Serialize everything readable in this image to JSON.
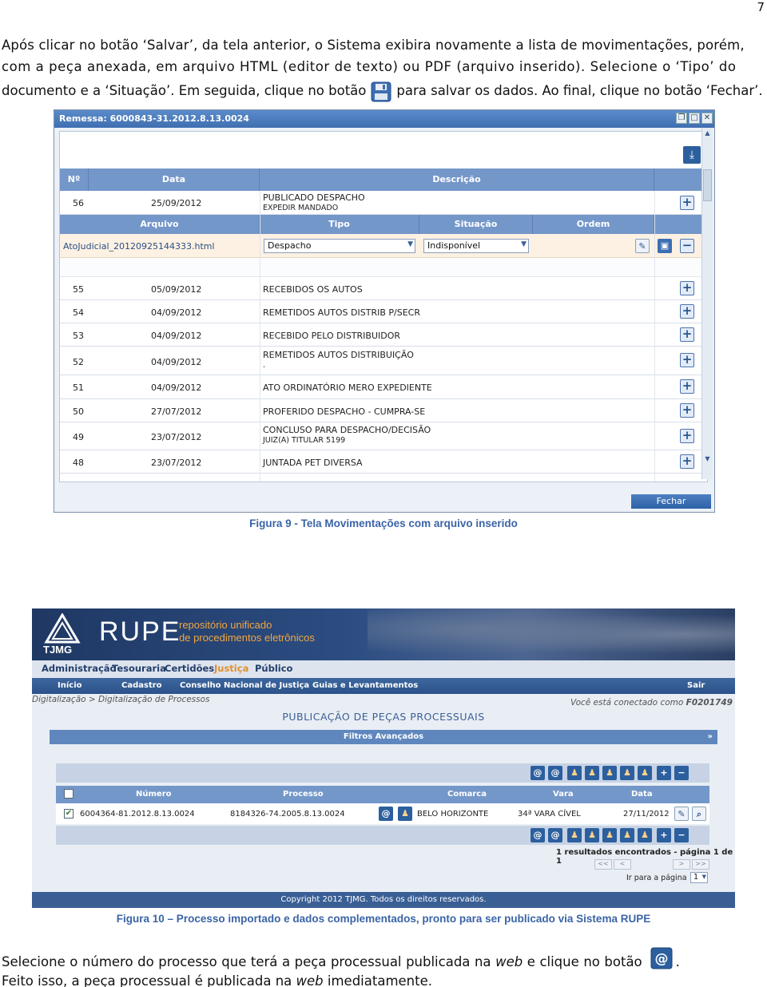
{
  "page_number": "7",
  "intro": {
    "line1": "Após clicar no botão ‘Salvar’, da tela anterior, o Sistema exibira novamente a lista de movimentações, porém,",
    "line2": "com a peça anexada, em arquivo HTML (editor de texto) ou PDF (arquivo inserido). Selecione o ‘Tipo’ do",
    "line3a": "documento e a ‘Situação’. Em seguida, clique no botão",
    "line3b": "para salvar os dados. Ao final, clique no botão ‘Fechar’."
  },
  "fig9": {
    "window_title": "Remessa: 6000843-31.2012.8.13.0024",
    "headers": {
      "num": "Nº",
      "date": "Data",
      "desc": "Descrição"
    },
    "attach_headers": {
      "file": "Arquivo",
      "type": "Tipo",
      "status": "Situação",
      "order": "Ordem"
    },
    "selected_row": {
      "num": "56",
      "date": "25/09/2012",
      "desc1": "PUBLICADO DESPACHO",
      "desc2": "EXPEDIR MANDADO"
    },
    "attachment": {
      "file": "AtoJudicial_20120925144333.html",
      "type": "Despacho",
      "status": "Indisponível"
    },
    "rows": [
      {
        "num": "55",
        "date": "05/09/2012",
        "desc1": "RECEBIDOS OS AUTOS",
        "desc2": ""
      },
      {
        "num": "54",
        "date": "04/09/2012",
        "desc1": "REMETIDOS AUTOS DISTRIB P/SECR",
        "desc2": ""
      },
      {
        "num": "53",
        "date": "04/09/2012",
        "desc1": "RECEBIDO PELO DISTRIBUIDOR",
        "desc2": ""
      },
      {
        "num": "52",
        "date": "04/09/2012",
        "desc1": "REMETIDOS AUTOS DISTRIBUIÇÃO",
        "desc2": "."
      },
      {
        "num": "51",
        "date": "04/09/2012",
        "desc1": "ATO ORDINATÓRIO MERO EXPEDIENTE",
        "desc2": ""
      },
      {
        "num": "50",
        "date": "27/07/2012",
        "desc1": "PROFERIDO DESPACHO - CUMPRA-SE",
        "desc2": ""
      },
      {
        "num": "49",
        "date": "23/07/2012",
        "desc1": "CONCLUSO PARA DESPACHO/DECISÃO",
        "desc2": "JUIZ(A) TITULAR 5199"
      },
      {
        "num": "48",
        "date": "23/07/2012",
        "desc1": "JUNTADA PET DIVERSA",
        "desc2": ""
      }
    ],
    "close_label": "Fechar",
    "caption": "Figura 9 - Tela Movimentações com arquivo inserido"
  },
  "fig10": {
    "logo_text": "TJMG",
    "brand": "RUPE",
    "brand_sub1": "repositório unificado",
    "brand_sub2": "de procedimentos eletrônicos",
    "menu": [
      "Administração",
      "Tesouraria",
      "Certidões",
      "Justiça",
      "Público"
    ],
    "submenu": [
      "Início",
      "Cadastro",
      "Conselho Nacional de Justiça",
      "Guias e Levantamentos"
    ],
    "exit": "Sair",
    "breadcrumb": "Digitalização > Digitalização de Processos",
    "connected": "Você está conectado como",
    "user": "F0201749",
    "page_title": "PUBLICAÇÃO DE PEÇAS PROCESSUAIS",
    "filters": "Filtros Avançados",
    "table_headers": {
      "numero": "Número",
      "processo": "Processo",
      "comarca": "Comarca",
      "vara": "Vara",
      "data": "Data"
    },
    "row": {
      "numero": "6004364-81.2012.8.13.0024",
      "processo": "8184326-74.2005.8.13.0024",
      "comarca": "BELO HORIZONTE",
      "vara": "34ª VARA CÍVEL",
      "data": "27/11/2012"
    },
    "results": "1 resultados encontrados - página 1 de 1",
    "pager": [
      "<<",
      "<",
      ">",
      ">>"
    ],
    "goto_label": "Ir para a página",
    "goto_value": "1",
    "copyright": "Copyright 2012 TJMG. Todos os direitos reservados.",
    "caption": "Figura 10 – Processo importado e dados complementados, pronto para ser publicado via Sistema RUPE"
  },
  "outro": {
    "line1a": "Selecione o número do processo que terá a peça processual publicada na",
    "line1b": "web",
    "line1c": "e clique no botão",
    "line1d": ".",
    "line2a": "Feito isso, a peça processual é publicada na",
    "line2b": "web",
    "line2c": "imediatamente."
  },
  "colors": {
    "caption": "#3b64a6",
    "header_blue": "#7497c9",
    "rupe_dark": "#1f3863"
  }
}
